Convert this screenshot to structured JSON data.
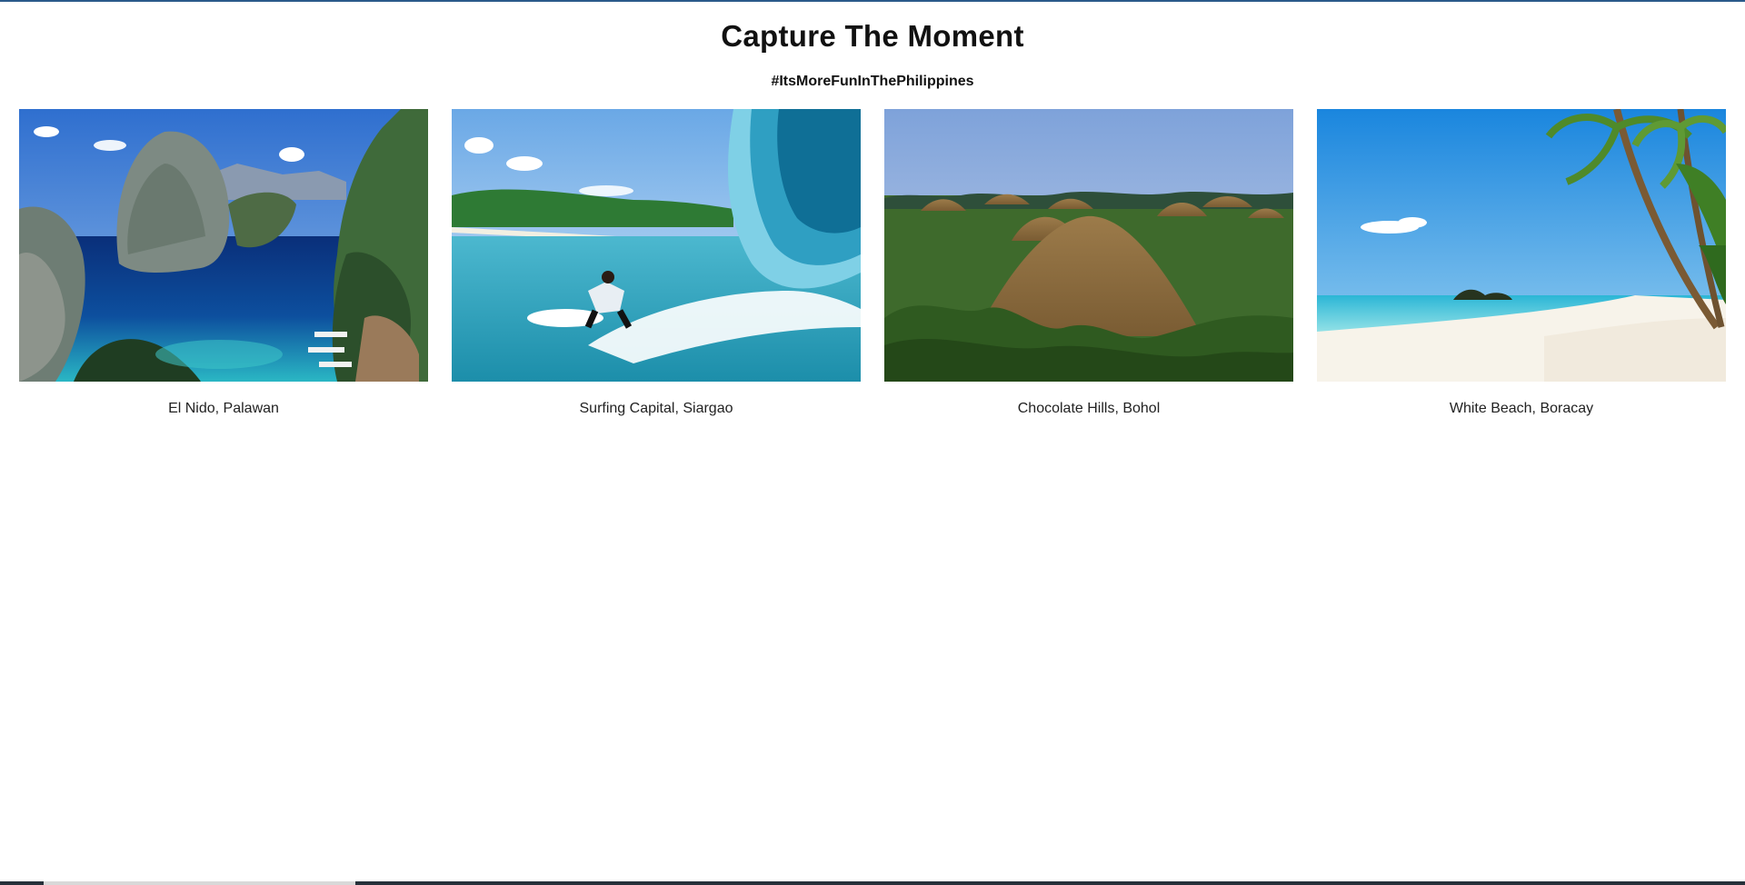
{
  "page": {
    "title": "Capture The Moment",
    "hashtag": "#ItsMoreFunInThePhilippines"
  },
  "gallery": {
    "items": [
      {
        "caption": "El Nido, Palawan",
        "image": "lagoon-cliffs-photo"
      },
      {
        "caption": "Surfing Capital, Siargao",
        "image": "surfer-wave-photo"
      },
      {
        "caption": "Chocolate Hills, Bohol",
        "image": "chocolate-hills-photo"
      },
      {
        "caption": "White Beach, Boracay",
        "image": "palm-beach-photo"
      }
    ]
  },
  "colors": {
    "accent": "#2b5a8a"
  }
}
